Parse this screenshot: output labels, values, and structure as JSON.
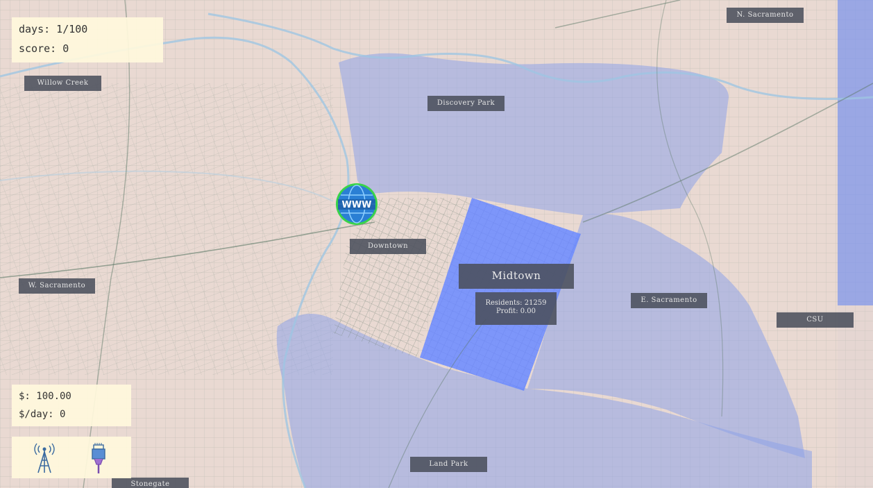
{
  "stats": {
    "days": "days: 1/100",
    "score": "score: 0"
  },
  "money": {
    "balance": "$: 100.00",
    "per_day": "$/day: 0"
  },
  "hub": {
    "label": "WWW"
  },
  "neighborhoods": {
    "willow_creek": "Willow Creek",
    "discovery_park": "Discovery Park",
    "n_sacramento": "N. Sacramento",
    "downtown": "Downtown",
    "w_sacramento": "W. Sacramento",
    "e_sacramento": "E. Sacramento",
    "csu": "CSU",
    "land_park": "Land Park",
    "stonegate": "Stonegate"
  },
  "selected_region": {
    "name": "Midtown",
    "residents": "Residents: 21259",
    "profit": "Profit: 0.00"
  },
  "tools": [
    {
      "name": "cell-tower"
    },
    {
      "name": "ethernet-cable"
    }
  ],
  "colors": {
    "region_highlight": "#6d8cff",
    "region_overlay": "#8c9fe6",
    "hub_ring": "#39d34a",
    "hub_globe": "#2a7fd4"
  }
}
